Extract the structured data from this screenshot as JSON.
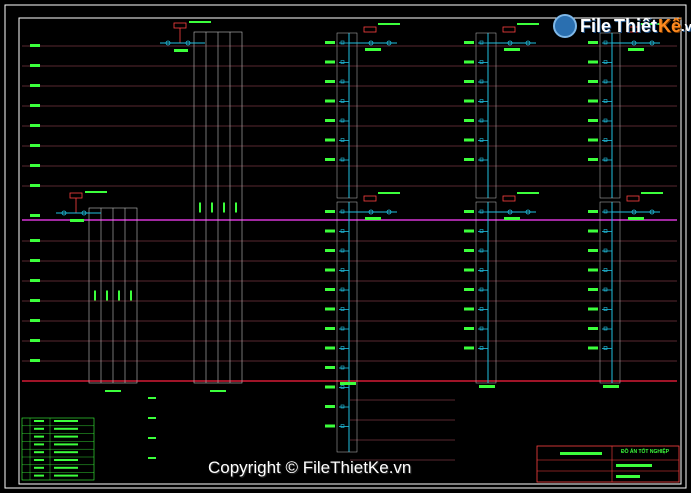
{
  "watermark": {
    "logo_part1": "File",
    "logo_part2": "Thiết",
    "logo_part3": "Kế",
    "logo_suffix": ".vn",
    "copyright": "Copyright © FileThietKe.vn"
  },
  "title_block": {
    "project": "ĐỒ ÁN TỐT NGHIỆP"
  },
  "colors": {
    "background": "#000000",
    "frame": "#ffffff",
    "ground_line": "#ff2040",
    "division_line": "#ff40ff",
    "floor_line": "#b05060",
    "pipe": "#20c0e0",
    "pipe_outline": "#c0c0c0",
    "label": "#3cff3c",
    "tank": "#ff4040"
  },
  "diagram": {
    "type": "plumbing riser schematic",
    "risers_top_group": 3,
    "risers_bottom_group": 3,
    "fixtures_per_riser": 8
  }
}
